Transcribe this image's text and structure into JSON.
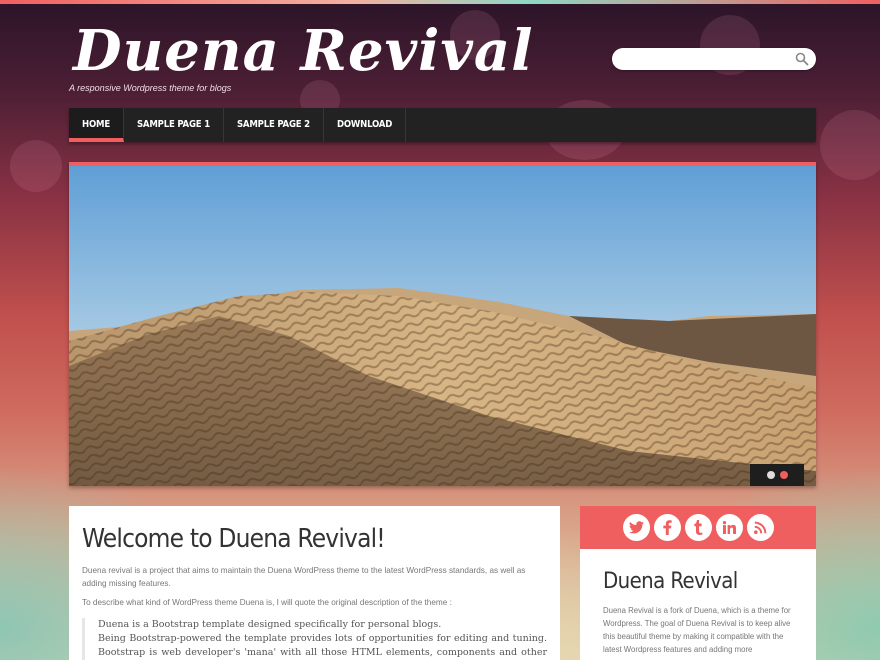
{
  "site": {
    "title": "Duena Revival",
    "tagline": "A responsive Wordpress theme for blogs"
  },
  "search": {
    "placeholder": "",
    "icon": "search-icon"
  },
  "nav": {
    "items": [
      {
        "label": "HOME",
        "active": true
      },
      {
        "label": "SAMPLE PAGE 1",
        "active": false
      },
      {
        "label": "SAMPLE PAGE 2",
        "active": false
      },
      {
        "label": "DOWNLOAD",
        "active": false
      }
    ]
  },
  "slider": {
    "image": "desert-dune-photo",
    "slide_count": 2,
    "active_slide": 2
  },
  "post": {
    "title": "Welcome to Duena Revival!",
    "intro": "Duena revival is a project that aims to maintain the Duena WordPress theme to the latest WordPress standards, as well as adding missing features.",
    "quote_intro": "To describe what kind of WordPress theme Duena is, I will quote the original description of the theme :",
    "quote_line1": "Duena is a Bootstrap template designed specifically for personal blogs.",
    "quote_line2": "Being Bootstrap-powered the template provides lots of opportunities for editing and tuning. Bootstrap is web developer's 'mana' with all those HTML elements, components and other cool stuff"
  },
  "sidebar": {
    "social": [
      "twitter-icon",
      "facebook-icon",
      "tumblr-icon",
      "linkedin-icon",
      "rss-icon"
    ],
    "widget_title": "Duena Revival",
    "widget_text": "Duena Revival is a fork of Duena, which is a theme for Wordpress. The goal of Duena Revival is to keep alive this beautiful theme by making it compatible with the latest Wordpress features and adding more"
  },
  "colors": {
    "accent": "#f05f5f",
    "nav_bg": "#222222",
    "text": "#333333"
  }
}
